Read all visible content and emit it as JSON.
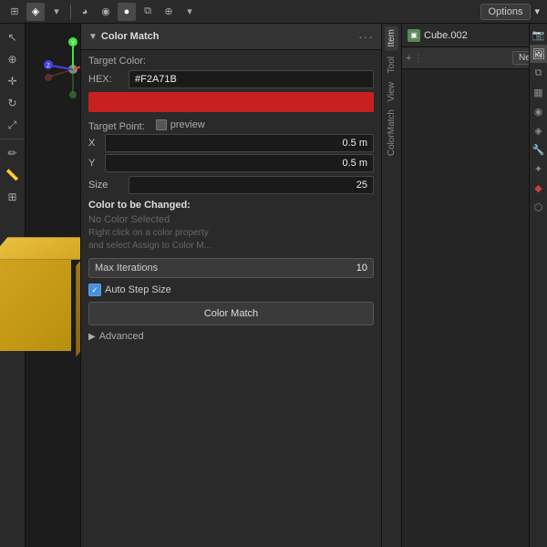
{
  "topbar": {
    "options_label": "Options",
    "dropdown_arrow": "▾"
  },
  "viewport": {
    "gizmo": {
      "x_label": "X",
      "y_label": "Y",
      "z_label": "Z"
    }
  },
  "colormatch": {
    "panel_title": "Color Match",
    "target_color_label": "Target Color:",
    "hex_label": "HEX:",
    "hex_value": "#F2A71B",
    "color_swatch_bg": "#c82020",
    "target_point_label": "Target Point:",
    "preview_label": "preview",
    "x_label": "X",
    "x_value": "0.5 m",
    "y_label": "Y",
    "y_value": "0.5 m",
    "size_label": "Size",
    "size_value": "25",
    "color_changed_label": "Color to be Changed:",
    "no_color_text": "No Color Selected",
    "hint_line1": "Right click on a color property",
    "hint_line2": "and select Assign to Color M...",
    "max_iter_label": "Max Iterations",
    "max_iter_value": "10",
    "auto_step_label": "Auto Step Size",
    "color_match_btn": "Color Match",
    "advanced_label": "Advanced"
  },
  "right_panel": {
    "cube_name": "Cube.002",
    "new_btn": "New",
    "tabs": {
      "item_label": "Item",
      "tool_label": "Tool",
      "view_label": "View",
      "colormatch_label": "ColorMatch"
    }
  },
  "props_sidebar": {
    "icons": [
      "🔧",
      "📷",
      "🔵",
      "◻",
      "⚡",
      "🔗",
      "✦",
      "♦",
      "🎯",
      "⬡"
    ]
  }
}
